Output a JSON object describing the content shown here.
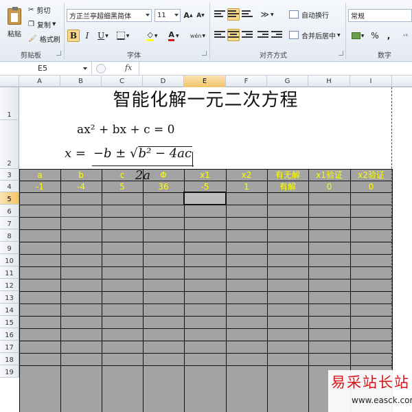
{
  "ribbon": {
    "clipboard": {
      "title": "剪贴板",
      "paste": "粘贴",
      "cut": "剪切",
      "copy": "复制",
      "format_painter": "格式刷"
    },
    "font": {
      "title": "字体",
      "font_name": "方正兰亭超细黑简体",
      "font_size": "11",
      "bold": "B",
      "italic": "I",
      "underline": "U",
      "grow": "A",
      "shrink": "A",
      "font_color": "A",
      "phonetic": "wén"
    },
    "alignment": {
      "title": "对齐方式",
      "wrap_text": "自动换行",
      "merge_center": "合并后居中"
    },
    "number": {
      "title": "数字",
      "format": "常规",
      "percent": "%",
      "comma": ","
    }
  },
  "formula_bar": {
    "name_box": "E5",
    "fx": "fx",
    "formula": ""
  },
  "columns": [
    "A",
    "B",
    "C",
    "D",
    "E",
    "F",
    "G",
    "H",
    "I"
  ],
  "rows": [
    "1",
    "2",
    "3",
    "4",
    "5",
    "6",
    "7",
    "8",
    "9",
    "10",
    "11",
    "12",
    "13",
    "14",
    "15",
    "16",
    "17",
    "18",
    "19"
  ],
  "sheet": {
    "title": "智能化解一元二次方程",
    "equation": "ax² + bx + c = 0",
    "formula_lhs": "x =",
    "formula_num_pre": "−b ± ",
    "formula_num_sqrt": "b² − 4ac",
    "formula_den": "2a",
    "headers": [
      "a",
      "b",
      "c",
      "Φ",
      "x1",
      "x2",
      "有无解",
      "x1验证",
      "x2验证"
    ],
    "values": [
      "-1",
      "-4",
      "5",
      "36",
      "-5",
      "1",
      "有解",
      "0",
      "0"
    ]
  },
  "colors": {
    "cell_fill": "#a3a3a3",
    "text_yellow": "#ffff00",
    "watermark_red": "#d8141d"
  },
  "watermark": {
    "brand": "易采站长站",
    "url": "www.easck.com"
  }
}
